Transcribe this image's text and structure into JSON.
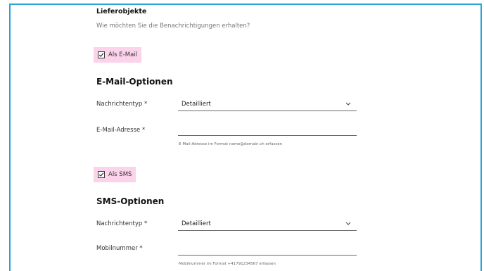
{
  "delivery": {
    "title": "Lieferobjekte",
    "subtitle": "Wie möchten Sie die Benachrichtigungen erhalten?"
  },
  "email": {
    "checkbox_label": "Als E-Mail",
    "checked": true,
    "section_title": "E-Mail-Optionen",
    "type_label": "Nachrichtentyp *",
    "type_value": "Detailliert",
    "address_label": "E-Mail-Adresse *",
    "address_value": "",
    "address_helper": "E-Mail-Adresse im Format name@domain.ch erfassen"
  },
  "sms": {
    "checkbox_label": "Als SMS",
    "checked": true,
    "section_title": "SMS-Optionen",
    "type_label": "Nachrichtentyp *",
    "type_value": "Detailliert",
    "mobile_label": "Mobilnummer *",
    "mobile_value": "",
    "mobile_helper": "Mobilnummer im Format +41791234567 erfassen"
  },
  "colors": {
    "frame_border": "#2aa3d6",
    "checkbox_highlight": "#fbd3ea"
  },
  "icons": {
    "checkbox": "check-icon",
    "dropdown": "chevron-down-icon"
  }
}
